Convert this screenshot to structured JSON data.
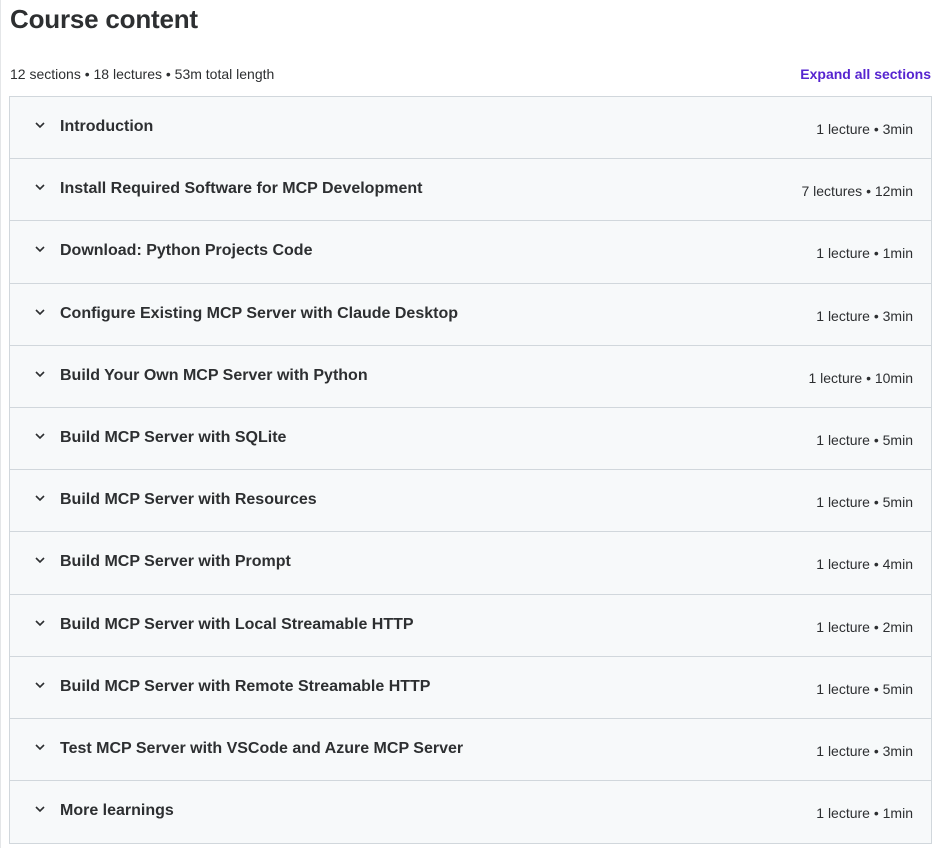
{
  "header": {
    "title": "Course content",
    "summary": "12 sections • 18 lectures • 53m total length",
    "expand_label": "Expand all sections"
  },
  "sections": [
    {
      "title": "Introduction",
      "meta": "1 lecture • 3min"
    },
    {
      "title": "Install Required Software for MCP Development",
      "meta": "7 lectures • 12min"
    },
    {
      "title": "Download: Python Projects Code",
      "meta": "1 lecture • 1min"
    },
    {
      "title": "Configure Existing MCP Server with Claude Desktop",
      "meta": "1 lecture • 3min"
    },
    {
      "title": "Build Your Own MCP Server with Python",
      "meta": "1 lecture • 10min"
    },
    {
      "title": "Build MCP Server with SQLite",
      "meta": "1 lecture • 5min"
    },
    {
      "title": "Build MCP Server with Resources",
      "meta": "1 lecture • 5min"
    },
    {
      "title": "Build MCP Server with Prompt",
      "meta": "1 lecture • 4min"
    },
    {
      "title": "Build MCP Server with Local Streamable HTTP",
      "meta": "1 lecture • 2min"
    },
    {
      "title": "Build MCP Server with Remote Streamable HTTP",
      "meta": "1 lecture • 5min"
    },
    {
      "title": "Test MCP Server with VSCode and Azure MCP Server",
      "meta": "1 lecture • 3min"
    },
    {
      "title": "More learnings",
      "meta": "1 lecture • 1min"
    }
  ],
  "icons": {
    "section_toggle": "chevron-down-icon"
  },
  "colors": {
    "accent": "#5624d0",
    "section_bg": "#f7f9fa",
    "border": "#d1d7dc",
    "text": "#2d2f31"
  }
}
